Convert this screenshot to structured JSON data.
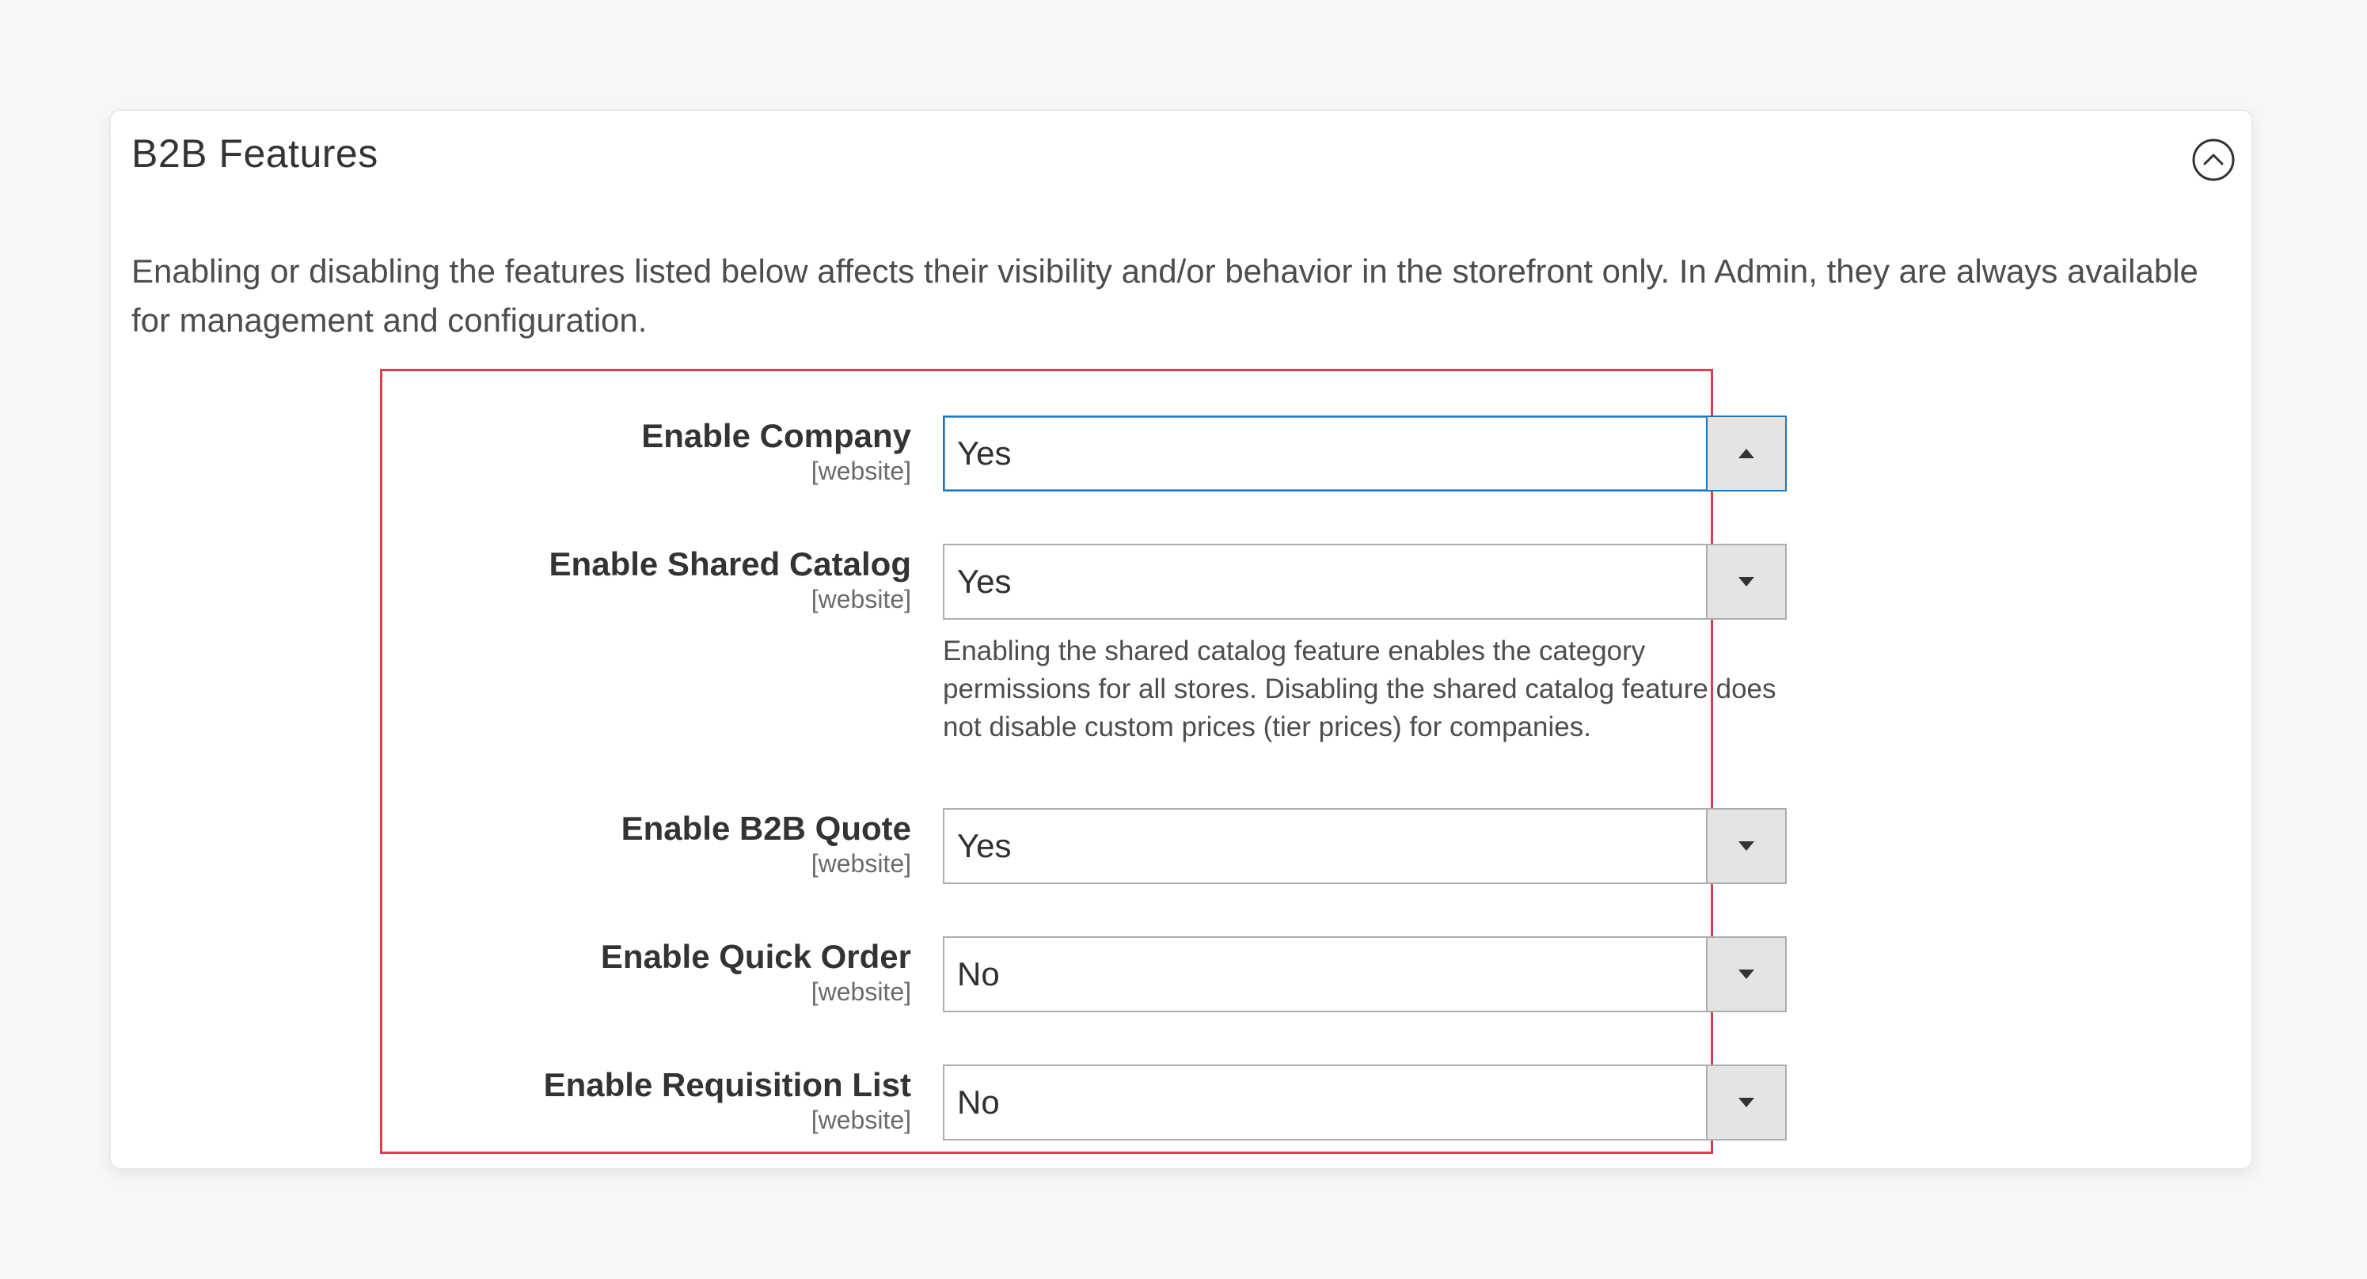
{
  "panel": {
    "title": "B2B Features",
    "description": "Enabling or disabling the features listed below affects their visibility and/or behavior in the storefront only. In Admin, they are always available for management and configuration."
  },
  "icons": {
    "collapse": "chevron-up-circle-icon",
    "dropdown_open": "triangle-up-icon",
    "dropdown_closed": "triangle-down-icon"
  },
  "colors": {
    "highlight_border": "#e03c4e",
    "focus_border": "#1979c3"
  },
  "fields": [
    {
      "label": "Enable Company",
      "scope": "[website]",
      "value": "Yes",
      "open": true
    },
    {
      "label": "Enable Shared Catalog",
      "scope": "[website]",
      "value": "Yes",
      "note": "Enabling the shared catalog feature enables the category permissions for all stores. Disabling the shared catalog feature does not disable custom prices (tier prices) for companies."
    },
    {
      "label": "Enable B2B Quote",
      "scope": "[website]",
      "value": "Yes"
    },
    {
      "label": "Enable Quick Order",
      "scope": "[website]",
      "value": "No"
    },
    {
      "label": "Enable Requisition List",
      "scope": "[website]",
      "value": "No"
    }
  ]
}
